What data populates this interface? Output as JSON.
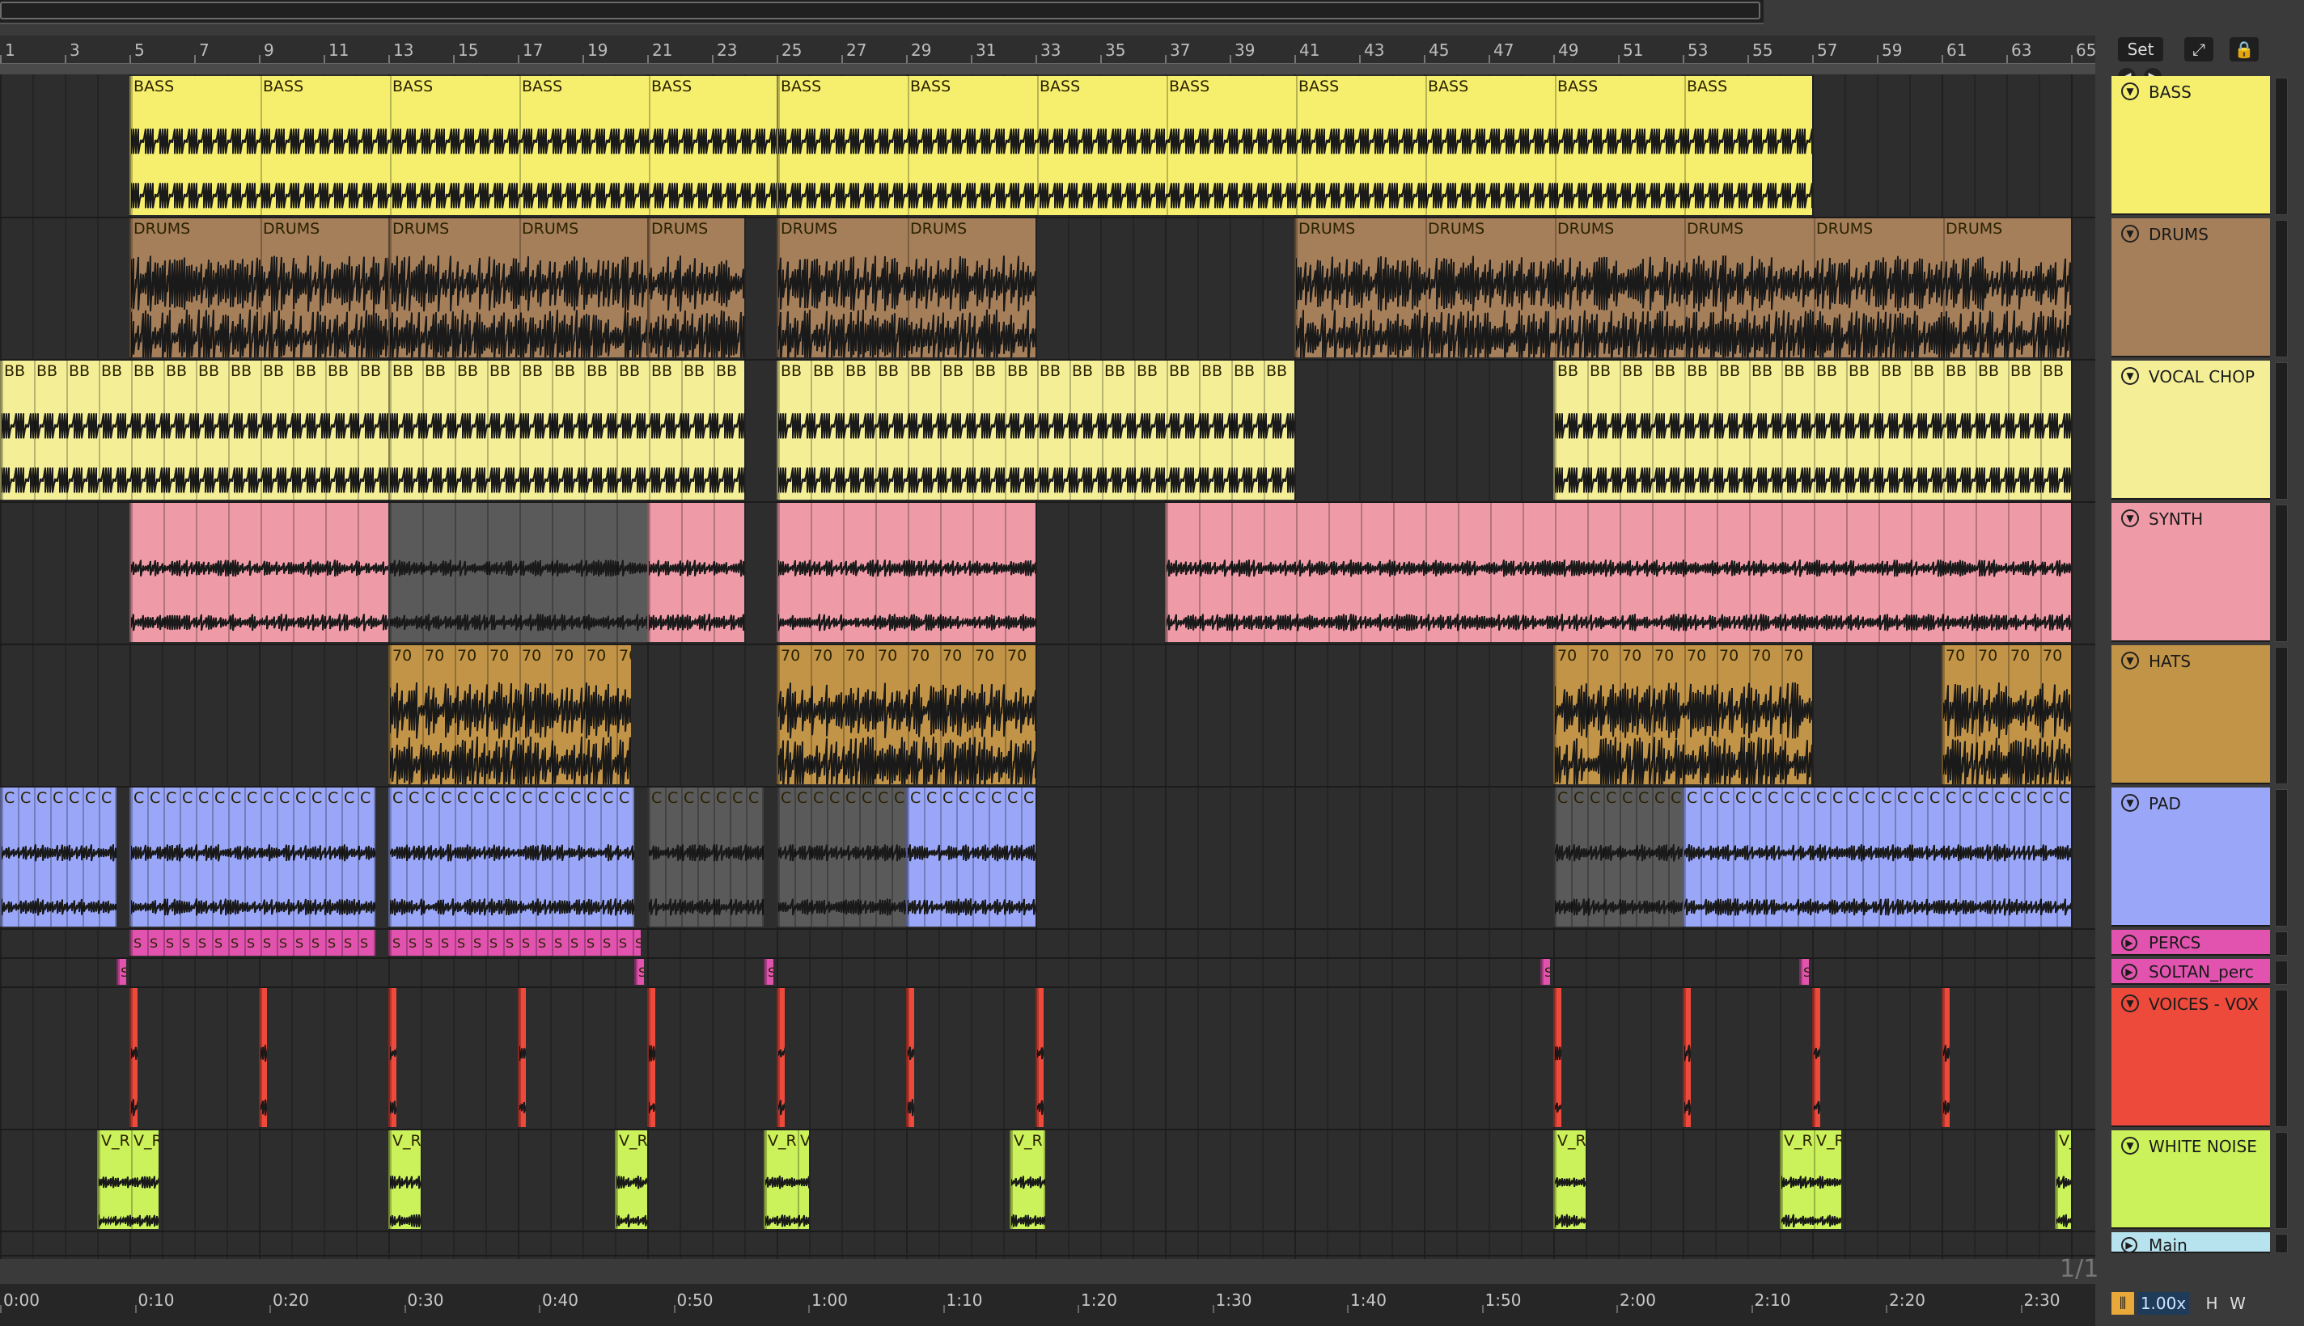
{
  "header": {
    "set_label": "Set",
    "bar_numbers": [
      "1",
      "3",
      "5",
      "7",
      "9",
      "11",
      "13",
      "15",
      "17",
      "19",
      "21",
      "23",
      "25",
      "27",
      "29",
      "31",
      "33",
      "35",
      "37",
      "39",
      "41",
      "43",
      "45",
      "47",
      "49",
      "51",
      "53",
      "55",
      "57",
      "59",
      "61",
      "63",
      "65"
    ]
  },
  "tracks": [
    {
      "name": "BASS",
      "color": "#f6ef6e",
      "clip_label": "BASS"
    },
    {
      "name": "DRUMS",
      "color": "#a57e5a",
      "clip_label": "DRUMS"
    },
    {
      "name": "VOCAL CHOP",
      "color": "#f4ef97",
      "clip_label": "BB"
    },
    {
      "name": "SYNTH",
      "color": "#ee9ba7",
      "clip_label": ""
    },
    {
      "name": "HATS",
      "color": "#c29448",
      "clip_label": "70"
    },
    {
      "name": "PAD",
      "color": "#9aa7f8",
      "clip_label": "C"
    },
    {
      "name": "PERCS",
      "color": "#e153ae",
      "clip_label": "S"
    },
    {
      "name": "SOLTAN_perc",
      "color": "#e153ae",
      "clip_label": "S"
    },
    {
      "name": "VOICES - VOX",
      "color": "#ee4a3c",
      "clip_label": ""
    },
    {
      "name": "WHITE NOISE",
      "color": "#cbf25a",
      "clip_label": "V_R"
    },
    {
      "name": "Main",
      "color": "#b7e3ef",
      "clip_label": ""
    }
  ],
  "timeline": {
    "labels": [
      "0:00",
      "0:10",
      "0:20",
      "0:30",
      "0:40",
      "0:50",
      "1:00",
      "1:10",
      "1:20",
      "1:30",
      "1:40",
      "1:50",
      "2:00",
      "2:10",
      "2:20",
      "2:30"
    ]
  },
  "footer": {
    "page_indicator": "1/1",
    "zoom": "1.00x",
    "h_label": "H",
    "w_label": "W"
  },
  "colors": {
    "bass": "#f6ef6e",
    "drums": "#a57e5a",
    "vocal_chop": "#f4ef97",
    "synth": "#ee9ba7",
    "hats": "#c29448",
    "pad": "#9aa7f8",
    "percs": "#e153ae",
    "voices": "#ee4a3c",
    "white_noise": "#cbf25a",
    "main": "#b7e3ef",
    "inactive_clip": "#5a5a5a"
  },
  "icons": [
    "fold-icon",
    "expand-icon",
    "lock-icon",
    "nav-left-icon",
    "nav-right-icon"
  ]
}
